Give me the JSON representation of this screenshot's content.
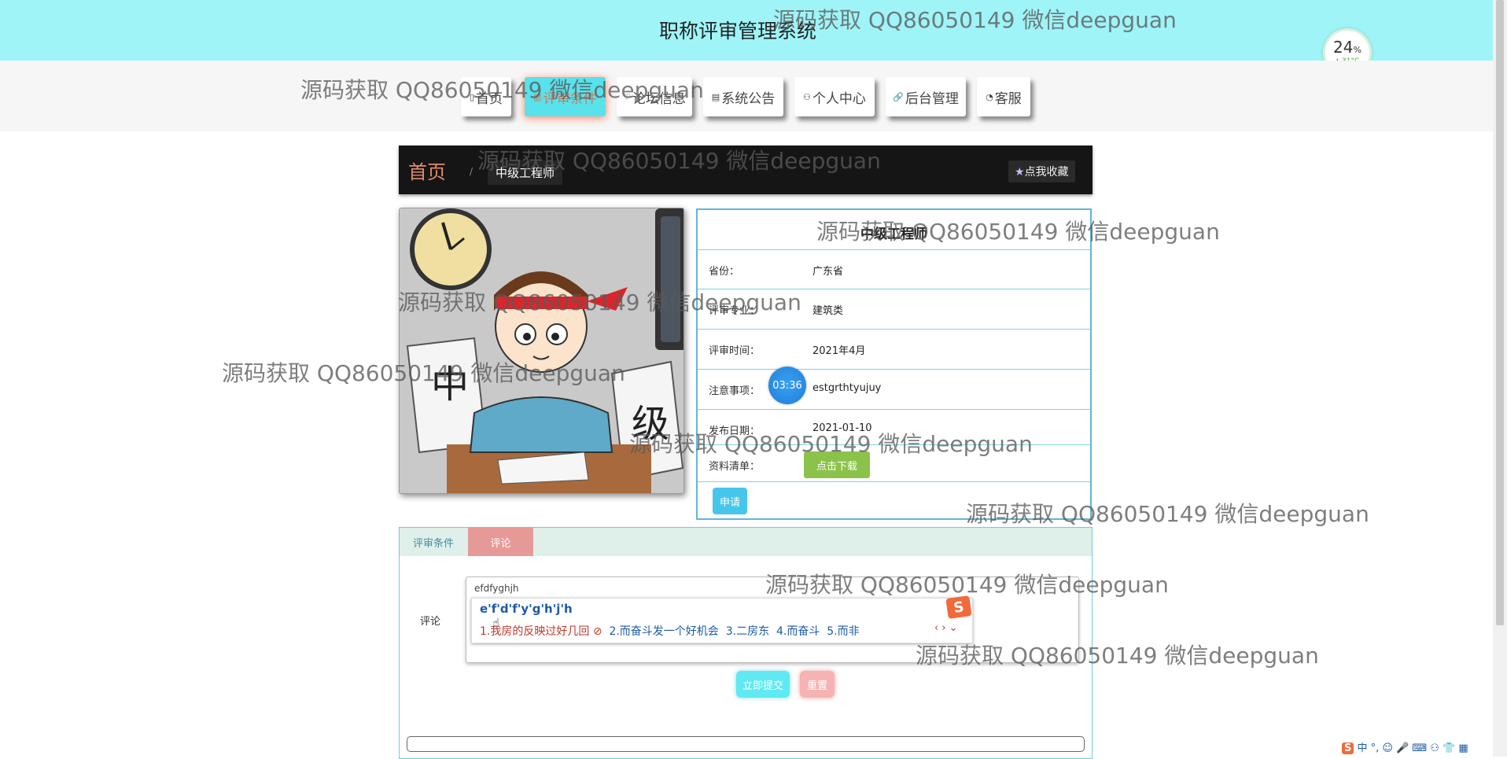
{
  "header": {
    "title": "职称评审管理系统"
  },
  "nav": [
    {
      "icon": "▯",
      "label": "首页"
    },
    {
      "icon": "▥",
      "label": "评审条件"
    },
    {
      "icon": "♡",
      "label": "论坛信息"
    },
    {
      "icon": "▤",
      "label": "系统公告"
    },
    {
      "icon": "⚇",
      "label": "个人中心"
    },
    {
      "icon": "🔗",
      "label": "后台管理"
    },
    {
      "icon": "◔",
      "label": "客服"
    }
  ],
  "weather": {
    "percent": "24",
    "percent_unit": "%",
    "temp": "🌢 31°C"
  },
  "breadcrumb": {
    "home": "首页",
    "sep": "/",
    "current": "中级工程师"
  },
  "favorite_label": "点我收藏",
  "detail": {
    "title": "中级工程师",
    "province_label": "省份：",
    "province": "广东省",
    "major_label": "评审专业：",
    "major": "建筑类",
    "time_label": "评审时间：",
    "time": "2021年4月",
    "notes_label": "注意事项：",
    "notes": "estgrthtyujuy",
    "date_label": "发布日期：",
    "date": "2021-01-10",
    "materials_label": "资料清单：",
    "download_label": "点击下载",
    "apply_label": "申请"
  },
  "timer": "03:36",
  "tabs": [
    {
      "label": "评审条件"
    },
    {
      "label": "评论"
    }
  ],
  "comment": {
    "label": "评论",
    "text": "efdfyghjh",
    "ime_composition": "e'f'd'f'y'g'h'j'h",
    "candidates": [
      "1.我房的反映过好几回",
      "2.而奋斗发一个好机会",
      "3.二房东",
      "4.而奋斗",
      "5.而非"
    ],
    "ime_arrows": "‹ › ⌄",
    "ime_logo": "S"
  },
  "submit_label": "立即提交",
  "reset_label": "重置",
  "tray": "中 °, ☺ 🎤 ⌨ ⚇ 👕 ▦",
  "watermark_text": "源码获取 QQ86050149 微信deepguan",
  "colors": {
    "topbar": "#9ff4f8",
    "active_nav": "#58e2ec",
    "crumbbar": "#151515",
    "download": "#8bc34a",
    "apply": "#46c6ea",
    "tab_active": "#e69a98"
  }
}
